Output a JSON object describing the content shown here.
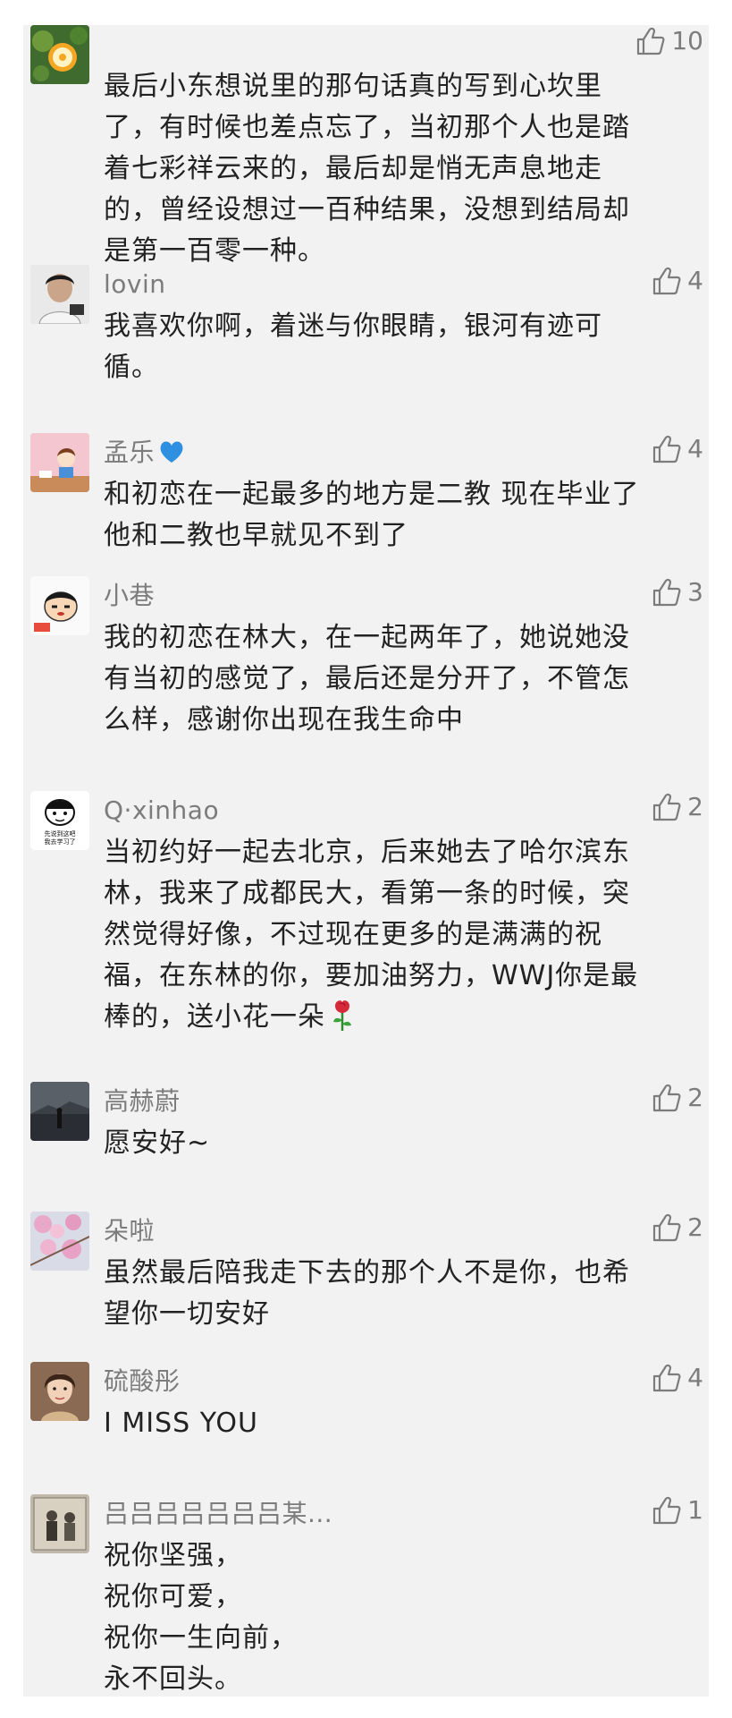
{
  "comments": [
    {
      "avatar_icon": "orange-slice-avatar-icon",
      "nickname": "",
      "likes": "10",
      "lines": [
        "最后小东想说里的那句话真的写到心坎里",
        "了，有时候也差点忘了，当初那个人也是踏",
        "着七彩祥云来的，最后却是悄无声息地走",
        "的，曾经设想过一百种结果，没想到结局却",
        "是第一百零一种。"
      ]
    },
    {
      "avatar_icon": "boy-portrait-avatar-icon",
      "nickname": "lovin",
      "likes": "4",
      "lines": [
        "我喜欢你啊，着迷与你眼睛，银河有迹可",
        "循。"
      ]
    },
    {
      "avatar_icon": "cartoon-girl-reading-avatar-icon",
      "nickname": "孟乐",
      "nickname_emoji": "blue-heart-icon",
      "likes": "4",
      "lines": [
        "和初恋在一起最多的地方是二教 现在毕业了",
        "他和二教也早就见不到了"
      ]
    },
    {
      "avatar_icon": "crayon-shinchan-avatar-icon",
      "nickname": "小巷",
      "likes": "3",
      "lines": [
        "我的初恋在林大，在一起两年了，她说她没",
        "有当初的感觉了，最后还是分开了，不管怎",
        "么样，感谢你出现在我生命中"
      ]
    },
    {
      "avatar_icon": "meme-face-avatar-icon",
      "avatar_text": [
        "先说到这吧",
        "我去学习了"
      ],
      "nickname": "Q·xinhao",
      "likes": "2",
      "lines": [
        "当初约好一起去北京，后来她去了哈尔滨东",
        "林，我来了成都民大，看第一条的时候，突",
        "然觉得好像，不过现在更多的是满满的祝",
        "福，在东林的你，要加油努力，WWJ你是最",
        "棒的，送小花一朵"
      ],
      "trailing_emoji": "rose-icon"
    },
    {
      "avatar_icon": "dark-street-avatar-icon",
      "nickname": "高赫蔚",
      "likes": "2",
      "lines": [
        "愿安好~"
      ]
    },
    {
      "avatar_icon": "pink-blossom-avatar-icon",
      "nickname": "朵啦",
      "likes": "2",
      "lines": [
        "虽然最后陪我走下去的那个人不是你，也希",
        "望你一切安好"
      ]
    },
    {
      "avatar_icon": "girl-portrait-avatar-icon",
      "nickname": "硫酸彤",
      "likes": "4",
      "lines": [
        "I MISS YOU"
      ]
    },
    {
      "avatar_icon": "vintage-photo-avatar-icon",
      "nickname": "吕吕吕吕吕吕吕某...",
      "likes": "1",
      "lines": [
        "祝你坚强，",
        "祝你可爱，",
        "祝你一生向前，",
        "永不回头。"
      ]
    }
  ],
  "colors": {
    "panel_bg": "#f2f2f2",
    "nickname": "#7c7c7c",
    "content": "#222222",
    "like": "#7c7c7c"
  }
}
